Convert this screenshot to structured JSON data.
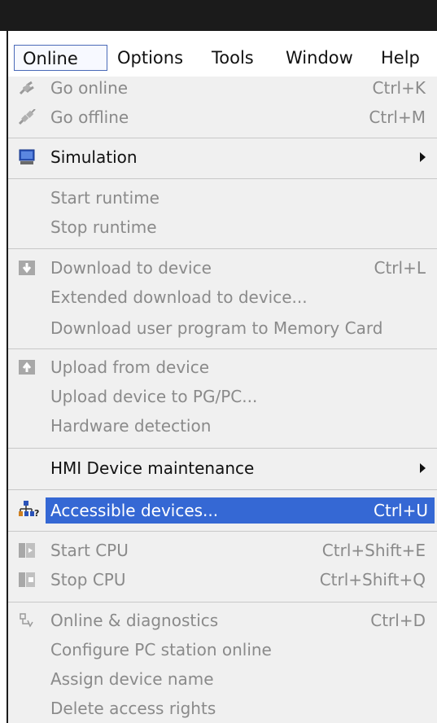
{
  "menubar": {
    "items": [
      {
        "label": "Online"
      },
      {
        "label": "Options"
      },
      {
        "label": "Tools"
      },
      {
        "label": "Window"
      },
      {
        "label": "Help"
      }
    ]
  },
  "menu": {
    "go_online": {
      "label": "Go online",
      "shortcut": "Ctrl+K",
      "icon": "go-online-icon"
    },
    "go_offline": {
      "label": "Go offline",
      "shortcut": "Ctrl+M",
      "icon": "go-offline-icon"
    },
    "simulation": {
      "label": "Simulation",
      "icon": "simulation-icon"
    },
    "start_runtime": {
      "label": "Start runtime"
    },
    "stop_runtime": {
      "label": "Stop runtime"
    },
    "download_to_device": {
      "label": "Download to device",
      "shortcut": "Ctrl+L",
      "icon": "download-icon"
    },
    "extended_download": {
      "label": "Extended download to device..."
    },
    "download_user_program": {
      "label": "Download user program to Memory Card"
    },
    "upload_from_device": {
      "label": "Upload from device",
      "icon": "upload-icon"
    },
    "upload_device_pgpc": {
      "label": "Upload device to PG/PC..."
    },
    "hardware_detection": {
      "label": "Hardware detection"
    },
    "hmi_maintenance": {
      "label": "HMI Device maintenance"
    },
    "accessible_devices": {
      "label": "Accessible devices...",
      "shortcut": "Ctrl+U",
      "icon": "accessible-devices-icon"
    },
    "start_cpu": {
      "label": "Start CPU",
      "shortcut": "Ctrl+Shift+E",
      "icon": "start-cpu-icon"
    },
    "stop_cpu": {
      "label": "Stop CPU",
      "shortcut": "Ctrl+Shift+Q",
      "icon": "stop-cpu-icon"
    },
    "online_diagnostics": {
      "label": "Online & diagnostics",
      "shortcut": "Ctrl+D",
      "icon": "diagnostics-icon"
    },
    "configure_pc_station": {
      "label": "Configure PC station online"
    },
    "assign_device_name": {
      "label": "Assign device name"
    },
    "delete_access_rights": {
      "label": "Delete access rights"
    }
  },
  "colors": {
    "highlight": "#3568d4",
    "disabled_text": "#8a8a8a",
    "menu_background": "#f0f0f0"
  }
}
